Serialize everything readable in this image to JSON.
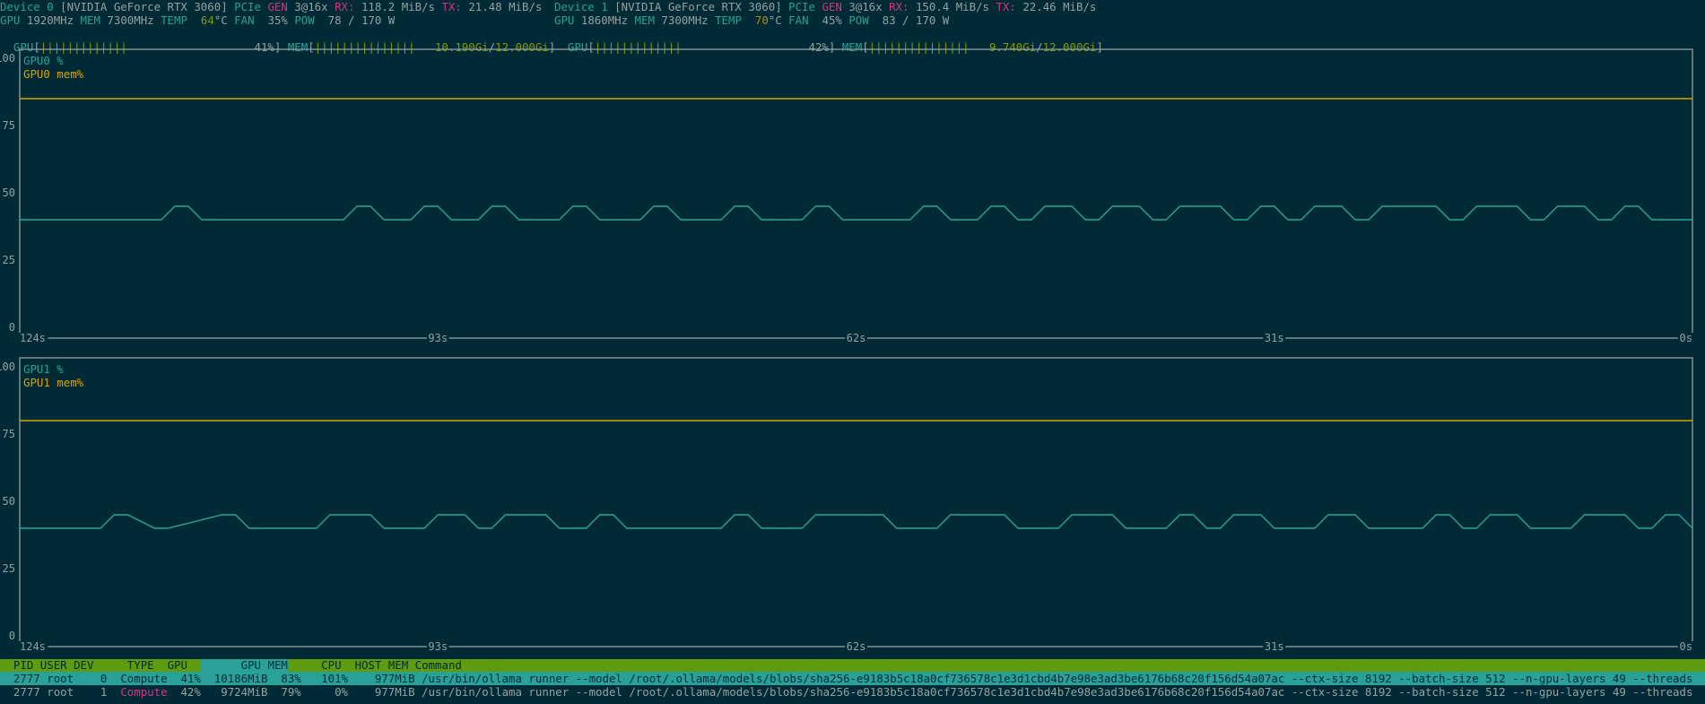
{
  "devices": [
    {
      "label": "Device 0",
      "name": "[NVIDIA GeForce RTX 3060]",
      "pcie_label": "PCIe",
      "gen_label": "GEN",
      "gen_value": "3@16x",
      "rx_label": "RX:",
      "rx_value": "118.2 MiB/s",
      "tx_label": "TX:",
      "tx_value": "21.48 MiB/s",
      "gpu_clock_label": "GPU",
      "gpu_clock": "1920MHz",
      "mem_clock_label": "MEM",
      "mem_clock": "7300MHz",
      "temp_label": "TEMP",
      "temp_value": "64",
      "temp_unit": "°C",
      "fan_label": "FAN",
      "fan_value": "35%",
      "pow_label": "POW",
      "pow_value": "78 / 170 W",
      "util_label": "GPU",
      "util_pct": 41,
      "util_text": "41%",
      "mem_label": "MEM",
      "mem_used": "10.190Gi",
      "mem_total": "12.000Gi",
      "mem_fraction": 0.849
    },
    {
      "label": "Device 1",
      "name": "[NVIDIA GeForce RTX 3060]",
      "pcie_label": "PCIe",
      "gen_label": "GEN",
      "gen_value": "3@16x",
      "rx_label": "RX:",
      "rx_value": "150.4 MiB/s",
      "tx_label": "TX:",
      "tx_value": "22.46 MiB/s",
      "gpu_clock_label": "GPU",
      "gpu_clock": "1860MHz",
      "mem_clock_label": "MEM",
      "mem_clock": "7300MHz",
      "temp_label": "TEMP",
      "temp_value": "70",
      "temp_unit": "°C",
      "fan_label": "FAN",
      "fan_value": "45%",
      "pow_label": "POW",
      "pow_value": "83 / 170 W",
      "util_label": "GPU",
      "util_pct": 42,
      "util_text": "42%",
      "mem_label": "MEM",
      "mem_used": "9.740Gi",
      "mem_total": "12.000Gi",
      "mem_fraction": 0.812
    }
  ],
  "colors": {
    "background": "#002b36",
    "util_line": "#2aa198",
    "mem_line": "#d9a400",
    "axis": "#93a1a1"
  },
  "chart_data": [
    {
      "type": "line",
      "legend": [
        "GPU0 %",
        "GPU0 mem%"
      ],
      "y_ticks": [
        "100",
        "75",
        "50",
        "25",
        "0"
      ],
      "ylim": [
        0,
        100
      ],
      "x_ticks": [
        "124s",
        "93s",
        "62s",
        "31s",
        "0s"
      ],
      "xlim": [
        124,
        0
      ],
      "x": [
        124,
        113.5,
        112.5,
        111.5,
        110.5,
        100,
        99,
        98,
        97,
        95,
        94,
        93,
        92,
        90,
        89,
        88,
        87,
        84,
        83,
        82,
        81,
        78,
        77,
        76,
        75,
        72,
        71,
        70,
        69,
        66,
        65,
        64,
        63,
        58,
        57,
        56,
        55,
        53,
        52,
        51,
        50,
        49,
        48,
        46,
        45,
        44,
        43,
        41,
        40,
        39,
        38,
        35,
        34,
        33,
        32,
        31,
        30,
        29,
        28,
        26,
        25,
        24,
        23,
        19,
        18,
        17,
        16,
        13,
        12,
        11,
        10,
        8,
        7,
        6,
        5,
        4,
        3,
        2,
        1,
        0
      ],
      "series": [
        {
          "name": "GPU0 %",
          "values": [
            40,
            40,
            45,
            45,
            40,
            40,
            45,
            45,
            40,
            40,
            45,
            45,
            40,
            40,
            45,
            45,
            40,
            40,
            45,
            45,
            40,
            40,
            45,
            45,
            40,
            40,
            45,
            45,
            40,
            40,
            45,
            45,
            40,
            40,
            45,
            45,
            40,
            40,
            45,
            45,
            40,
            40,
            45,
            45,
            40,
            40,
            45,
            45,
            40,
            40,
            45,
            45,
            40,
            40,
            45,
            45,
            40,
            40,
            45,
            45,
            40,
            40,
            45,
            45,
            40,
            40,
            45,
            45,
            40,
            40,
            45,
            45,
            40,
            40,
            45,
            45,
            40,
            40,
            40,
            40
          ]
        },
        {
          "name": "GPU0 mem%",
          "values": [
            85,
            85,
            85,
            85,
            85,
            85,
            85,
            85,
            85,
            85,
            85,
            85,
            85,
            85,
            85,
            85,
            85,
            85,
            85,
            85,
            85,
            85,
            85,
            85,
            85,
            85,
            85,
            85,
            85,
            85,
            85,
            85,
            85,
            85,
            85,
            85,
            85,
            85,
            85,
            85,
            85,
            85,
            85,
            85,
            85,
            85,
            85,
            85,
            85,
            85,
            85,
            85,
            85,
            85,
            85,
            85,
            85,
            85,
            85,
            85,
            85,
            85,
            85,
            85,
            85,
            85,
            85,
            85,
            85,
            85,
            85,
            85,
            85,
            85,
            85,
            85,
            85,
            85,
            85,
            85
          ]
        }
      ]
    },
    {
      "type": "line",
      "legend": [
        "GPU1 %",
        "GPU1 mem%"
      ],
      "y_ticks": [
        "100",
        "75",
        "50",
        "25",
        "0"
      ],
      "ylim": [
        0,
        100
      ],
      "x_ticks": [
        "124s",
        "93s",
        "62s",
        "31s",
        "0s"
      ],
      "xlim": [
        124,
        0
      ],
      "x": [
        124,
        118,
        117,
        116,
        114,
        113,
        109,
        108,
        107,
        102,
        101,
        98,
        97,
        94,
        93,
        91,
        90,
        89,
        88,
        85,
        84,
        82,
        81,
        80,
        79,
        72,
        71,
        70,
        69,
        66,
        65,
        60,
        59,
        56,
        55,
        51,
        50,
        47,
        46,
        43,
        42,
        39,
        38,
        37,
        36,
        35,
        34,
        32,
        31,
        28,
        27,
        25,
        24,
        20,
        19,
        18,
        17,
        16,
        15,
        13,
        12,
        9,
        8,
        5,
        4,
        3,
        2,
        1,
        0
      ],
      "series": [
        {
          "name": "GPU1 %",
          "values": [
            40,
            40,
            45,
            45,
            40,
            40,
            45,
            45,
            40,
            40,
            45,
            45,
            40,
            40,
            45,
            45,
            40,
            40,
            45,
            45,
            40,
            40,
            45,
            45,
            40,
            40,
            45,
            45,
            40,
            40,
            45,
            45,
            40,
            40,
            45,
            45,
            40,
            40,
            45,
            45,
            40,
            40,
            45,
            45,
            40,
            40,
            45,
            45,
            40,
            40,
            45,
            45,
            40,
            40,
            45,
            45,
            40,
            40,
            45,
            45,
            40,
            40,
            45,
            45,
            40,
            40,
            45,
            45,
            40
          ]
        },
        {
          "name": "GPU1 mem%",
          "values": [
            80,
            80,
            80,
            80,
            80,
            80,
            80,
            80,
            80,
            80,
            80,
            80,
            80,
            80,
            80,
            80,
            80,
            80,
            80,
            80,
            80,
            80,
            80,
            80,
            80,
            80,
            80,
            80,
            80,
            80,
            80,
            80,
            80,
            80,
            80,
            80,
            80,
            80,
            80,
            80,
            80,
            80,
            80,
            80,
            80,
            80,
            80,
            80,
            80,
            80,
            80,
            80,
            80,
            80,
            80,
            80,
            80,
            80,
            80,
            80,
            80,
            80,
            80,
            80,
            80,
            80,
            80,
            80,
            80
          ]
        }
      ]
    }
  ],
  "process_table": {
    "headers": {
      "pid": "PID",
      "user": "USER",
      "dev": "DEV",
      "type": "TYPE",
      "gpu": "GPU",
      "gpu_mem": "GPU MEM",
      "cpu": "CPU",
      "host_mem": "HOST MEM",
      "command": "Command"
    },
    "rows": [
      {
        "pid": "2777",
        "user": "root",
        "dev": "0",
        "type": "Compute",
        "gpu": "41%",
        "gpu_mem": "10186MiB",
        "gpu_mem_pct": "83%",
        "cpu": "101%",
        "host_mem": "977MiB",
        "command": "/usr/bin/ollama runner --model /root/.ollama/models/blobs/sha256-e9183b5c18a0cf736578c1e3d1cbd4b7e98e3ad3be6176b68c20f156d54a07ac --ctx-size 8192 --batch-size 512 --n-gpu-layers 49 --threads"
      },
      {
        "pid": "2777",
        "user": "root",
        "dev": "1",
        "type": "Compute",
        "gpu": "42%",
        "gpu_mem": "9724MiB",
        "gpu_mem_pct": "79%",
        "cpu": "0%",
        "host_mem": "977MiB",
        "command": "/usr/bin/ollama runner --model /root/.ollama/models/blobs/sha256-e9183b5c18a0cf736578c1e3d1cbd4b7e98e3ad3be6176b68c20f156d54a07ac --ctx-size 8192 --batch-size 512 --n-gpu-layers 49 --threads"
      }
    ]
  }
}
